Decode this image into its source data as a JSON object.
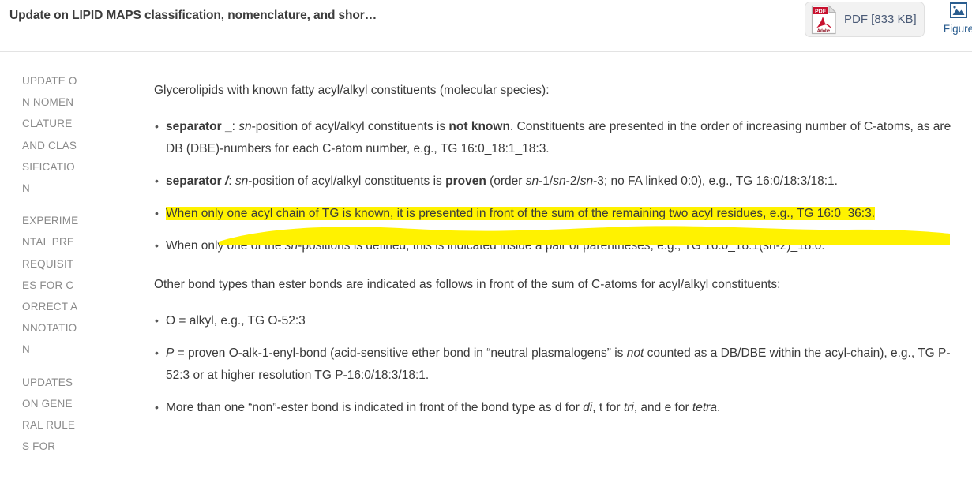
{
  "header": {
    "title": "Update on LIPID MAPS classification, nomenclature, and shor…",
    "pdf_button_label": "PDF [833 KB]",
    "pdf_icon_name": "pdf-adobe-icon",
    "pdf_icon_text": "PDF",
    "pdf_icon_brand": "Adobe",
    "figure_label": "Figure",
    "figure_icon_name": "image-icon"
  },
  "sidebar": {
    "items": [
      {
        "label": "UPDATE ON NOMENCLATURE AND CLASSIFICATION"
      },
      {
        "label": "EXPERIMENTAL PREREQUISITES FOR CORRECT ANNOTATION"
      },
      {
        "label": "UPDATES ON GENERAL RULES FOR"
      }
    ],
    "scrollbar_name": "sidebar-scrollbar"
  },
  "content": {
    "intro_paragraph": "Glycerolipids with known fatty acyl/alkyl constituents (molecular species):",
    "bullets_group_1": [
      {
        "id": "separator-underscore",
        "segments": [
          {
            "text": "separator ",
            "style": "bold"
          },
          {
            "text": "_",
            "style": "bold"
          },
          {
            "text": ": ",
            "style": "normal"
          },
          {
            "text": "sn",
            "style": "italic"
          },
          {
            "text": "-position of acyl/alkyl constituents is ",
            "style": "normal"
          },
          {
            "text": "not known",
            "style": "bold"
          },
          {
            "text": ". Constituents are presented in the order of increasing number of C-atoms, as are DB (DBE)-numbers for each C-atom number, e.g., TG 16:0_18:1_18:3.",
            "style": "normal"
          }
        ]
      },
      {
        "id": "separator-slash",
        "segments": [
          {
            "text": "separator ",
            "style": "bold"
          },
          {
            "text": "/",
            "style": "bold-italic"
          },
          {
            "text": ": ",
            "style": "normal"
          },
          {
            "text": "sn",
            "style": "italic"
          },
          {
            "text": "-position of acyl/alkyl constituents is ",
            "style": "normal"
          },
          {
            "text": "proven",
            "style": "bold"
          },
          {
            "text": " (order ",
            "style": "normal"
          },
          {
            "text": "sn",
            "style": "italic"
          },
          {
            "text": "-1/",
            "style": "normal"
          },
          {
            "text": "sn",
            "style": "italic"
          },
          {
            "text": "-2/",
            "style": "normal"
          },
          {
            "text": "sn",
            "style": "italic"
          },
          {
            "text": "-3; no FA linked 0:0), e.g., TG 16:0/18:3/18:1.",
            "style": "normal"
          }
        ]
      },
      {
        "id": "one-acyl-chain-known",
        "highlighted": true,
        "segments": [
          {
            "text": "When only one acyl chain of TG is known, it is presented in front of the sum of the remaining two acyl residues, e.g., TG 16:0_36:3.",
            "style": "normal"
          }
        ]
      },
      {
        "id": "one-sn-position-defined",
        "segments": [
          {
            "text": "When only one of the ",
            "style": "normal"
          },
          {
            "text": "sn",
            "style": "italic"
          },
          {
            "text": "-positions is defined, this is indicated inside a pair of parentheses, e.g., TG 16:0_18:1(sn-2)_18:0.",
            "style": "normal"
          }
        ]
      }
    ],
    "second_paragraph": "Other bond types than ester bonds are indicated as follows in front of the sum of C-atoms for acyl/alkyl constituents:",
    "bullets_group_2": [
      {
        "id": "o-alkyl",
        "segments": [
          {
            "text": "O = alkyl, e.g., TG O-52:3",
            "style": "normal"
          }
        ]
      },
      {
        "id": "p-proven",
        "segments": [
          {
            "text": "P",
            "style": "italic"
          },
          {
            "text": " = proven O-alk-1-enyl-bond (acid-sensitive ether bond in “neutral plasmalogens” is ",
            "style": "normal"
          },
          {
            "text": "not",
            "style": "italic"
          },
          {
            "text": " counted as a DB/DBE within the acyl-chain), e.g., TG P-52:3 or at higher resolution TG P-16:0/18:3/18:1.",
            "style": "normal"
          }
        ]
      },
      {
        "id": "more-than-one-non-ester",
        "segments": [
          {
            "text": "More than one “non”-ester bond is indicated in front of the bond type as d for ",
            "style": "normal"
          },
          {
            "text": "di",
            "style": "italic"
          },
          {
            "text": ", t for ",
            "style": "normal"
          },
          {
            "text": "tri",
            "style": "italic"
          },
          {
            "text": ", and e for ",
            "style": "normal"
          },
          {
            "text": "tetra",
            "style": "italic"
          },
          {
            "text": ".",
            "style": "normal"
          }
        ]
      }
    ]
  },
  "colors": {
    "highlight": "#fff200",
    "link": "#2a5d8f",
    "text": "#3a3a3a",
    "sidebar_text": "#8a8a8a",
    "pdf_red": "#c8102e"
  }
}
